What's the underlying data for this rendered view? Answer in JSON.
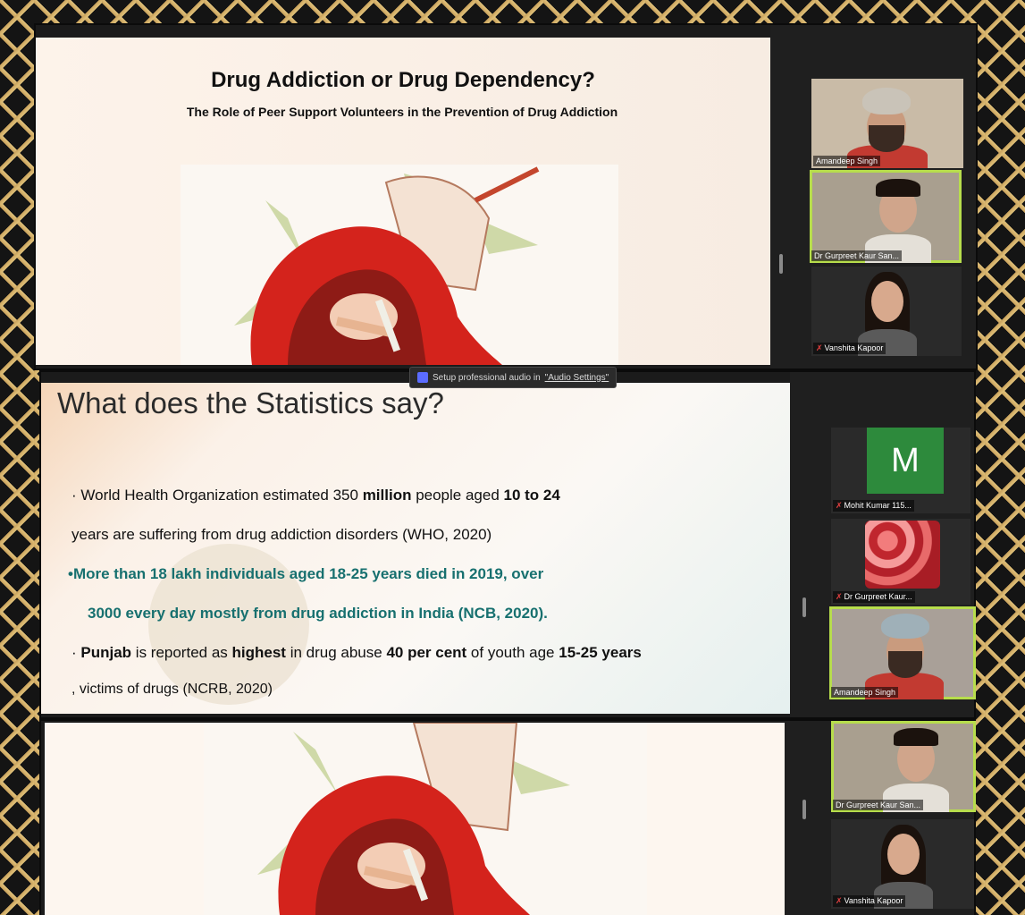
{
  "slide1": {
    "title": "Drug Addiction or Drug Dependency?",
    "subtitle": "The Role of Peer Support Volunteers in the Prevention of Drug Addiction"
  },
  "slide2": {
    "title": "What does the Statistics say?",
    "bullet1_a": "· World Health Organization estimated 350 ",
    "bullet1_b": "million",
    "bullet1_c": " people aged ",
    "bullet1_d": "10 to 24",
    "bullet1_line2": "years are suffering from drug addiction disorders (WHO, 2020)",
    "bullet2_line1": "•More than 18 lakh individuals aged 18-25 years died in 2019, over",
    "bullet2_line2": "3000 every day mostly from drug addiction in India (NCB, 2020).",
    "bullet3_dot": "· ",
    "bullet3_a": "Punjab",
    "bullet3_b": " is reported as ",
    "bullet3_c": "highest",
    "bullet3_d": " in drug abuse ",
    "bullet3_e": "40 per cent",
    "bullet3_f": " of youth age ",
    "bullet3_g": "15-25 years",
    "bullet3_line2": ", victims of drugs (NCRB, 2020)"
  },
  "toast": {
    "text": "Setup professional audio in",
    "link": "\"Audio Settings\""
  },
  "participants": {
    "panel1": [
      "Amandeep Singh",
      "Dr Gurpreet Kaur San...",
      "Vanshita Kapoor"
    ],
    "panel2": [
      "Mohit Kumar 115...",
      "Dr Gurpreet Kaur...",
      "Amandeep Singh"
    ],
    "panel3": [
      "Dr Gurpreet Kaur San...",
      "Vanshita Kapoor"
    ],
    "avatar_letter": "M"
  },
  "colors": {
    "teal_text": "#17706f",
    "active_speaker_border": "#b7dd4c",
    "avatar_green": "#2d8a3c",
    "border_gold": "#caa35d"
  }
}
